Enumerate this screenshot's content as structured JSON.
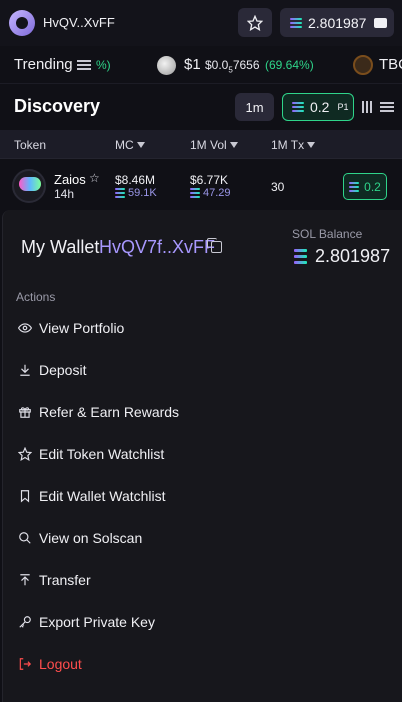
{
  "topbar": {
    "wallet_short": "HvQV..XvFF",
    "balance": "2.801987"
  },
  "trending": {
    "label": "Trending",
    "pct_partial": "%)",
    "token1_symbol": "$1",
    "token1_price_prefix": "$0.0",
    "token1_price_zeros": "5",
    "token1_price_digits": "7656",
    "token1_change": "(69.64%)",
    "token2_symbol": "TBC"
  },
  "discovery": {
    "title": "Discovery",
    "timeframe": "1m",
    "amount": "0.2",
    "preset": "P1"
  },
  "table": {
    "headers": [
      "Token",
      "MC",
      "1M Vol",
      "1M Tx"
    ],
    "rows": [
      {
        "name": "Zaios",
        "age": "14h",
        "mc": "$8.46M",
        "mc_sub": "59.1K",
        "vol": "$6.77K",
        "vol_sub": "47.29",
        "tx": "30",
        "buy_amount": "0.2"
      }
    ]
  },
  "wallet_panel": {
    "title": "My Wallet",
    "address": "HvQV7f..XvFF",
    "sol_balance_label": "SOL Balance",
    "sol_balance": "2.801987",
    "actions_label": "Actions",
    "actions": [
      {
        "label": "View Portfolio",
        "icon": "eye-icon"
      },
      {
        "label": "Deposit",
        "icon": "download-icon"
      },
      {
        "label": "Refer & Earn Rewards",
        "icon": "gift-icon"
      },
      {
        "label": "Edit Token Watchlist",
        "icon": "star-icon"
      },
      {
        "label": "Edit Wallet Watchlist",
        "icon": "bookmark-icon"
      },
      {
        "label": "View on Solscan",
        "icon": "search-icon"
      },
      {
        "label": "Transfer",
        "icon": "upload-icon"
      },
      {
        "label": "Export Private Key",
        "icon": "key-icon"
      },
      {
        "label": "Logout",
        "icon": "logout-icon"
      }
    ]
  },
  "colors": {
    "accent_purple": "#a898ff",
    "positive_green": "#2fd48a",
    "danger_red": "#ff4d4d",
    "background": "#101016"
  }
}
